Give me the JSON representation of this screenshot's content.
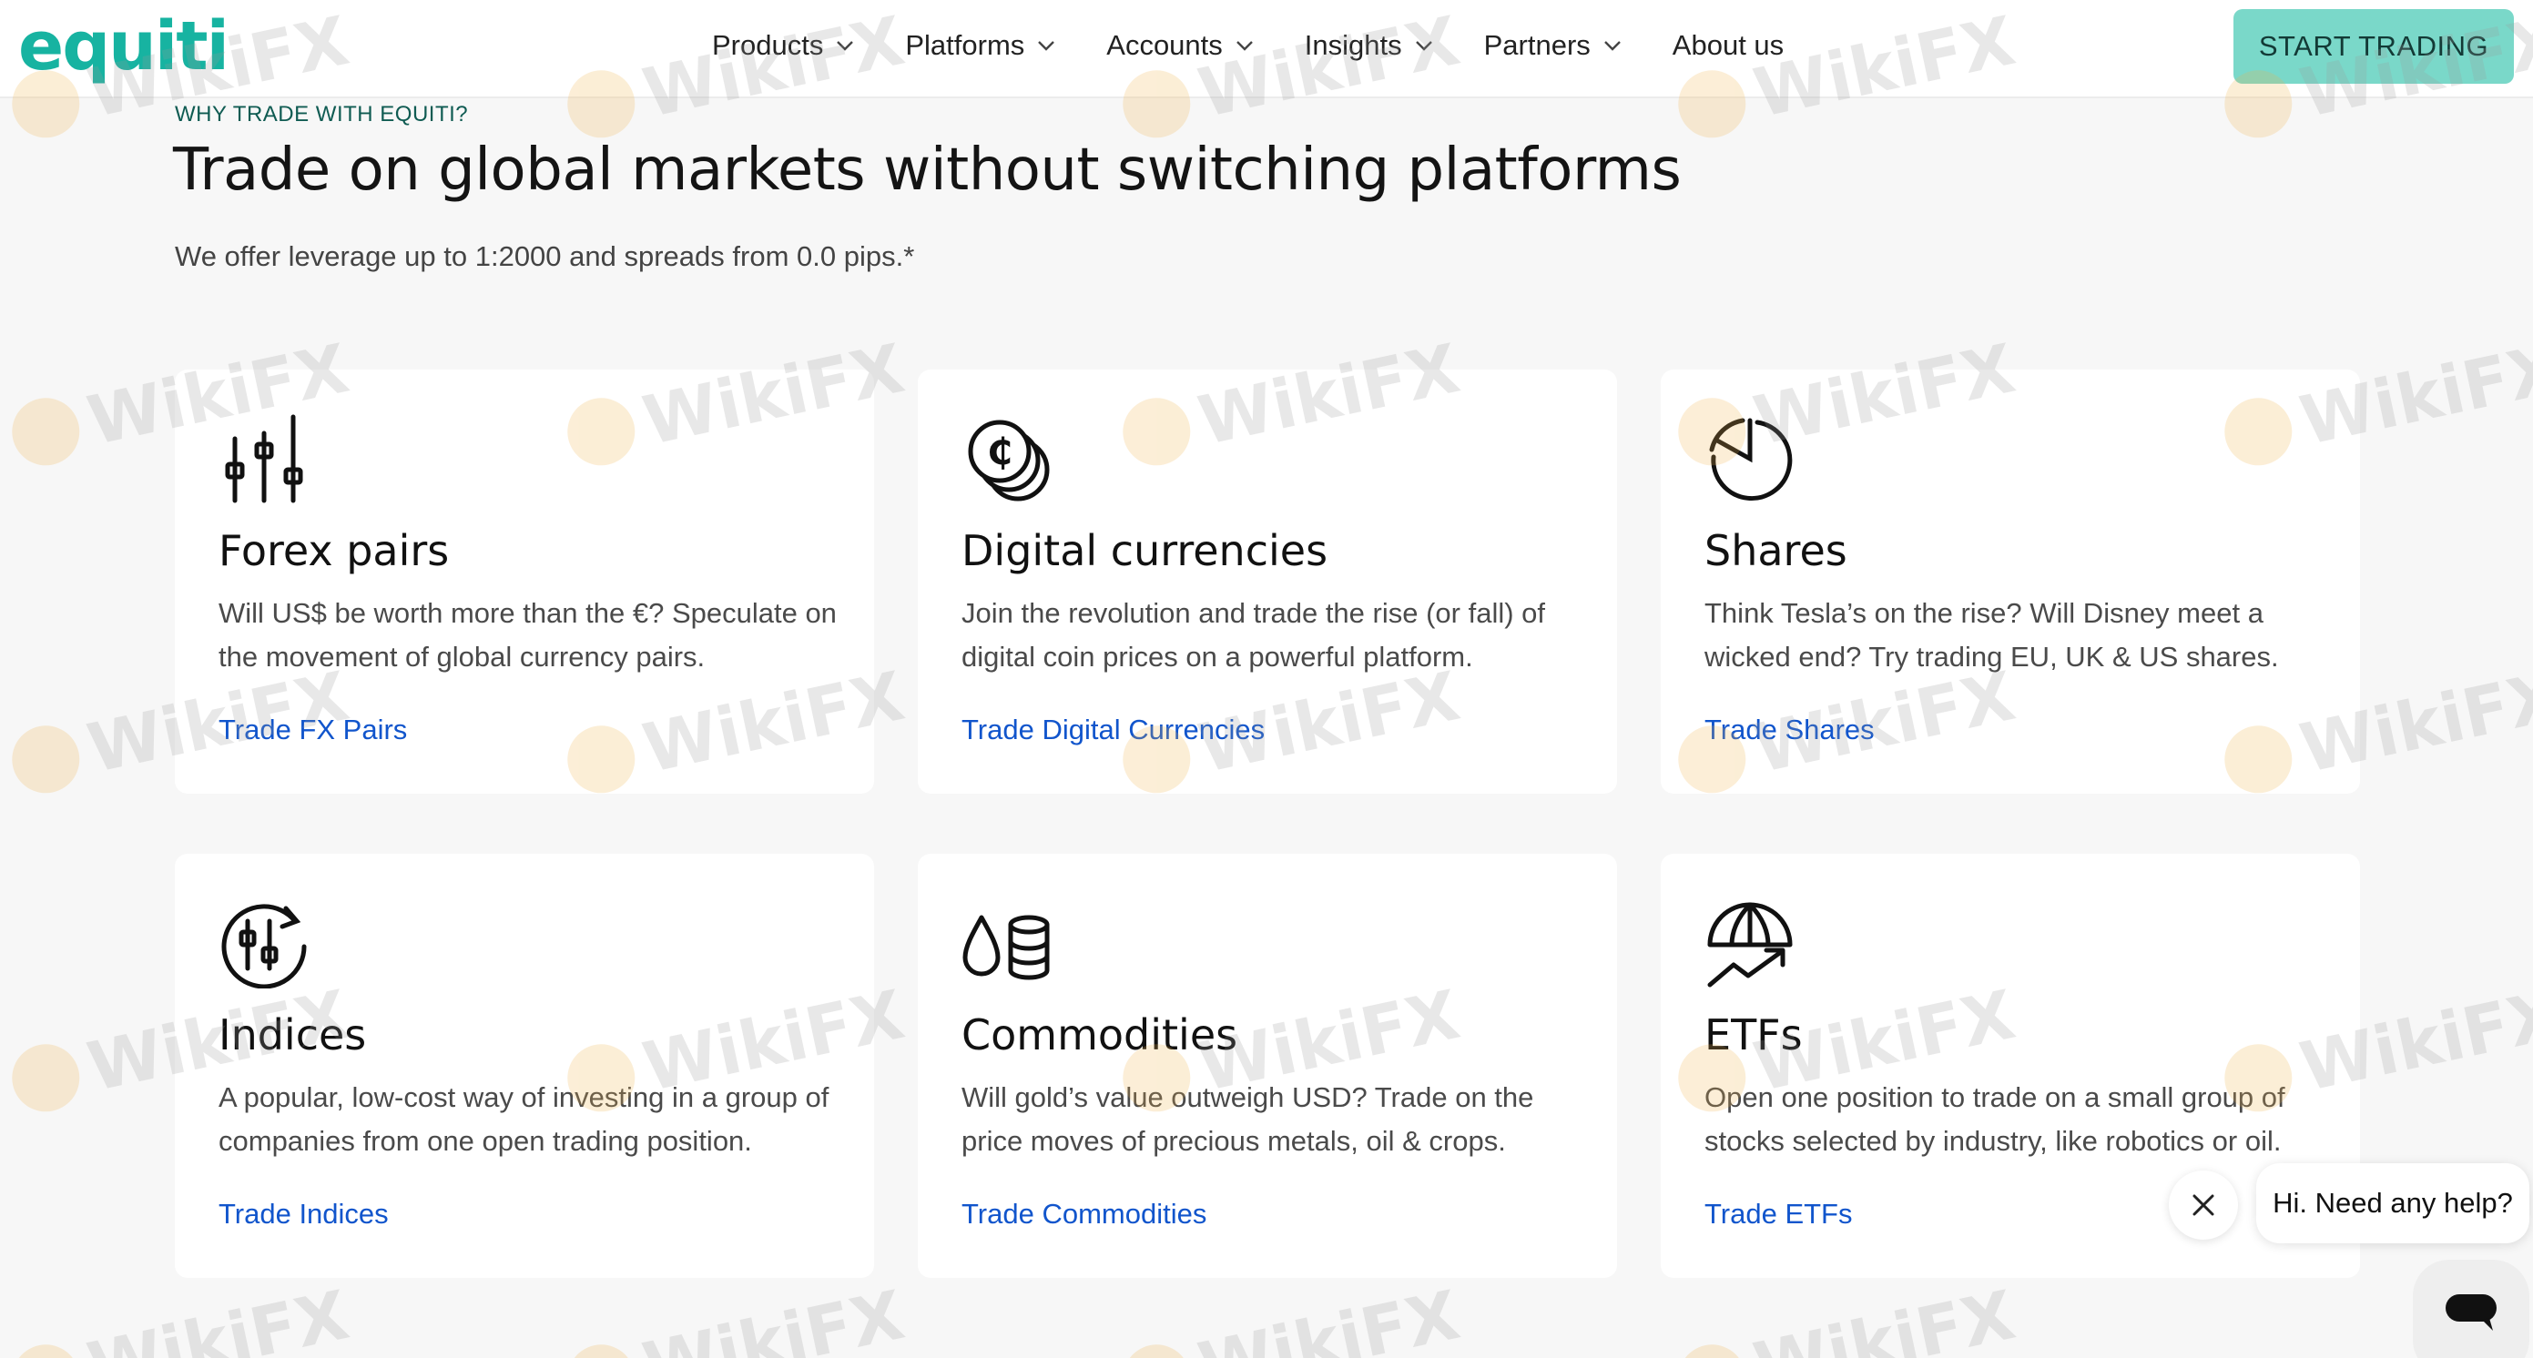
{
  "header": {
    "logo": "equiti",
    "nav": [
      {
        "label": "Products",
        "has_menu": true
      },
      {
        "label": "Platforms",
        "has_menu": true
      },
      {
        "label": "Accounts",
        "has_menu": true
      },
      {
        "label": "Insights",
        "has_menu": true
      },
      {
        "label": "Partners",
        "has_menu": true
      },
      {
        "label": "About us",
        "has_menu": false
      }
    ],
    "cta_label": "START TRADING"
  },
  "hero": {
    "eyebrow": "WHY TRADE WITH EQUITI?",
    "headline": "Trade on global markets without switching platforms",
    "subline": "We offer leverage up to 1:2000 and spreads from 0.0 pips.*"
  },
  "cards": [
    {
      "icon": "candlestick-chart-icon",
      "title": "Forex pairs",
      "description": "Will US$ be worth more than the €? Speculate on the movement of global currency pairs.",
      "link": "Trade FX Pairs"
    },
    {
      "icon": "crypto-coins-icon",
      "title": "Digital currencies",
      "description": "Join the revolution and trade the rise (or fall) of digital coin prices on a powerful platform.",
      "link": "Trade Digital Currencies"
    },
    {
      "icon": "pie-chart-icon",
      "title": "Shares",
      "description": "Think Tesla’s on the rise? Will Disney meet a wicked end? Try trading EU, UK & US shares.",
      "link": "Trade Shares"
    },
    {
      "icon": "index-cycle-icon",
      "title": "Indices",
      "description": "A popular, low-cost way of investing in a group of companies from one open trading position.",
      "link": "Trade Indices"
    },
    {
      "icon": "oil-drop-barrel-icon",
      "title": "Commodities",
      "description": "Will gold’s value outweigh USD? Trade on the price moves of precious metals, oil & crops.",
      "link": "Trade Commodities"
    },
    {
      "icon": "umbrella-trend-icon",
      "title": "ETFs",
      "description": "Open one position to trade on a small group of stocks selected by industry, like robotics or oil.",
      "link": "Trade ETFs"
    }
  ],
  "chat": {
    "greeting": "Hi. Need any help?"
  },
  "watermark": "WikiFX",
  "colors": {
    "brand_teal": "#17b3a1",
    "cta_bg": "#7ad8c9",
    "link_blue": "#1155cc",
    "eyebrow": "#0f5b52",
    "page_bg": "#f7f7f7"
  }
}
